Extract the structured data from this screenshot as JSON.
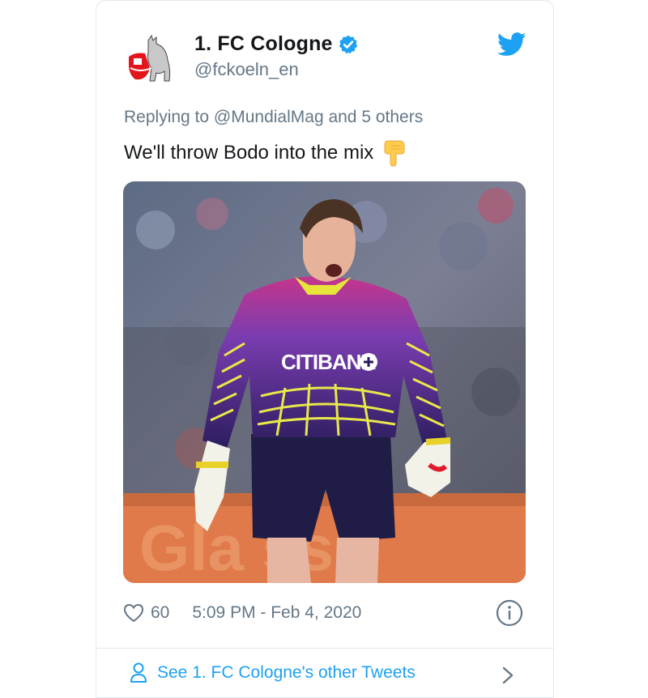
{
  "tweet": {
    "display_name": "1. FC Cologne",
    "handle": "@fckoeln_en",
    "reply_prefix": "Replying to",
    "reply_targets": "@MundialMag and 5 others",
    "text": "We'll throw Bodo into the mix",
    "emoji": "backhand-index-pointing-down",
    "photo_sponsor_text": "CITIBANK",
    "likes": "60",
    "timestamp": "5:09 PM - Feb 4, 2020",
    "footer_link": "See 1. FC Cologne's other Tweets"
  },
  "icons": {
    "verified": "verified-badge-icon",
    "brand": "twitter-bird-icon",
    "like": "heart-icon",
    "info": "info-icon",
    "profile": "person-icon",
    "more": "chevron-right-icon"
  },
  "colors": {
    "brand_blue": "#1da1f2",
    "text_primary": "#14171a",
    "text_secondary": "#657786",
    "border": "#e1e8ed"
  }
}
